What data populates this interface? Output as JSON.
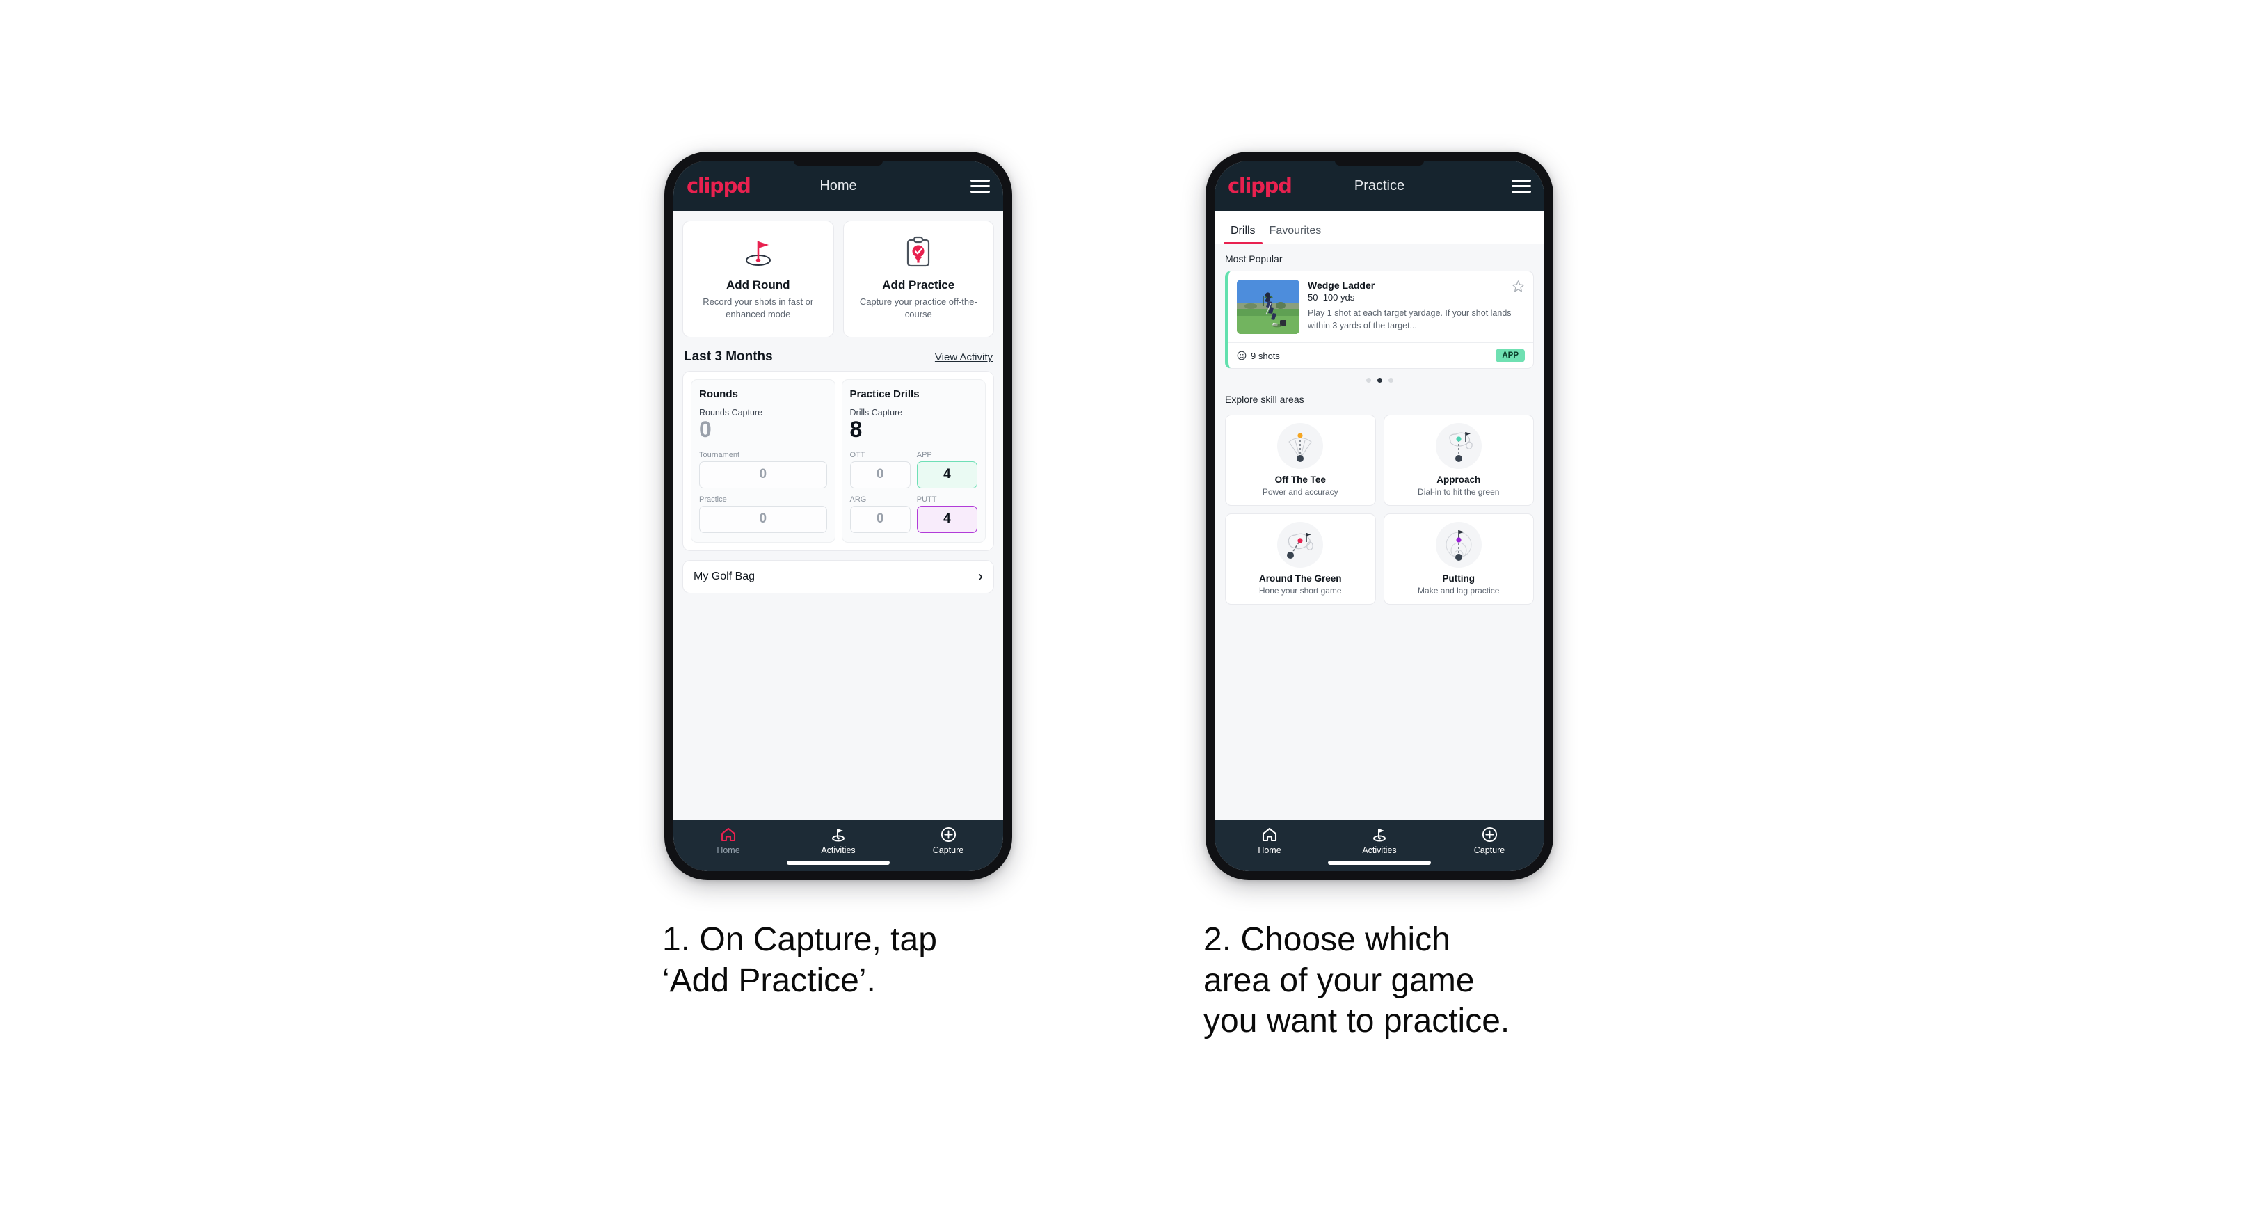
{
  "brand": "clippd",
  "phone1": {
    "appbar": {
      "title": "Home",
      "menu_icon": "hamburger-menu-icon"
    },
    "actions": [
      {
        "icon": "golf-flag-hole-icon",
        "title": "Add Round",
        "subtitle": "Record your shots in fast or enhanced mode"
      },
      {
        "icon": "clipboard-check-golf-tee-icon",
        "title": "Add Practice",
        "subtitle": "Capture your practice off-the-course"
      }
    ],
    "section": {
      "title": "Last 3 Months",
      "link": "View Activity"
    },
    "rounds": {
      "heading": "Rounds",
      "capture_label": "Rounds Capture",
      "capture_value": "0",
      "fields": [
        {
          "label": "Tournament",
          "value": "0",
          "state": "empty"
        },
        {
          "label": "Practice",
          "value": "0",
          "state": "empty"
        }
      ]
    },
    "drills": {
      "heading": "Practice Drills",
      "capture_label": "Drills Capture",
      "capture_value": "8",
      "fields": [
        {
          "label": "OTT",
          "value": "0",
          "state": "empty"
        },
        {
          "label": "APP",
          "value": "4",
          "state": "app"
        },
        {
          "label": "ARG",
          "value": "0",
          "state": "empty"
        },
        {
          "label": "PUTT",
          "value": "4",
          "state": "putt"
        }
      ]
    },
    "golf_bag": {
      "label": "My Golf Bag",
      "chevron": "chevron-right-icon"
    },
    "bottom_nav": [
      {
        "label": "Home",
        "icon": "home-icon",
        "active": true
      },
      {
        "label": "Activities",
        "icon": "golf-flag-icon",
        "active": false
      },
      {
        "label": "Capture",
        "icon": "plus-circle-icon",
        "active": false
      }
    ]
  },
  "phone2": {
    "appbar": {
      "title": "Practice",
      "menu_icon": "hamburger-menu-icon"
    },
    "tabs": [
      {
        "label": "Drills",
        "active": true
      },
      {
        "label": "Favourites",
        "active": false
      }
    ],
    "most_popular_label": "Most Popular",
    "drill": {
      "name": "Wedge Ladder",
      "yardage": "50–100 yds",
      "description": "Play 1 shot at each target yardage. If your shot lands within 3 yards of the target...",
      "shots": "9 shots",
      "shots_icon": "clock-icon",
      "tag": "APP",
      "favourite_icon": "star-outline-icon",
      "thumbnail": "golfer-chipping-photo"
    },
    "carousel_dots": {
      "count": 3,
      "active_index": 1
    },
    "explore_label": "Explore skill areas",
    "skills": [
      {
        "name": "Off The Tee",
        "subtitle": "Power and accuracy",
        "icon": "tee-dispersion-icon",
        "dot_color": "#f5a623"
      },
      {
        "name": "Approach",
        "subtitle": "Dial-in to hit the green",
        "icon": "green-approach-icon",
        "dot_color": "#4fd2b2"
      },
      {
        "name": "Around The Green",
        "subtitle": "Hone your short game",
        "icon": "chip-around-green-icon",
        "dot_color": "#e8214f"
      },
      {
        "name": "Putting",
        "subtitle": "Make and lag practice",
        "icon": "putting-rings-icon",
        "dot_color": "#9a20d6"
      }
    ],
    "bottom_nav": [
      {
        "label": "Home",
        "icon": "home-icon",
        "active": false
      },
      {
        "label": "Activities",
        "icon": "golf-flag-icon",
        "active": false
      },
      {
        "label": "Capture",
        "icon": "plus-circle-icon",
        "active": false
      }
    ]
  },
  "captions": {
    "step1": "1. On Capture, tap\n‘Add Practice’.",
    "step2": "2. Choose which\narea of your game\nyou want to practice."
  },
  "colors": {
    "brand_pink": "#e8214f",
    "appbar_dark": "#16242e",
    "nav_dark": "#1d2b36",
    "app_green": "#6fe0b2",
    "putt_purple": "#9a20d6"
  }
}
